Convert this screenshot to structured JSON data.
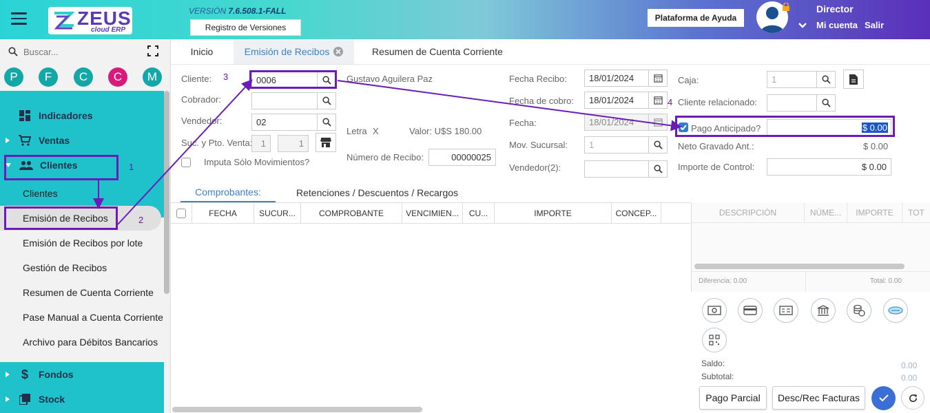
{
  "header": {
    "logo_text": "ZEUS",
    "logo_sub": "cloud ERP",
    "version_label": "VERSIÓN",
    "version_number": "7.6.508.1-FALL",
    "release_notes_button": "Registro de Versiones",
    "help_button": "Plataforma de Ayuda",
    "user_role": "Director",
    "account_link": "Mi cuenta",
    "logout_link": "Salir"
  },
  "sidebar": {
    "search_placeholder": "Buscar...",
    "favorites": [
      {
        "letter": "P",
        "color": "#14a7a7"
      },
      {
        "letter": "F",
        "color": "#14a7a7"
      },
      {
        "letter": "C",
        "color": "#14a7a7"
      },
      {
        "letter": "C",
        "color": "#d81b7a"
      },
      {
        "letter": "M",
        "color": "#14a7a7"
      }
    ],
    "sections": {
      "indicadores": "Indicadores",
      "ventas": "Ventas",
      "clientes": "Clientes",
      "fondos": "Fondos",
      "stock": "Stock"
    },
    "clientes_items": [
      "Clientes",
      "Emisión de Recibos",
      "Emisión de Recibos por lote",
      "Gestión de Recibos",
      "Resumen de Cuenta Corriente",
      "Pase Manual a Cuenta Corriente",
      "Archivo para Débitos Bancarios"
    ]
  },
  "tabs": {
    "inicio": "Inicio",
    "emision": "Emisión de Recibos",
    "resumen": "Resumen de Cuenta Corriente"
  },
  "form": {
    "cliente_label": "Cliente:",
    "cliente_value": "0006",
    "cliente_name": "Gustavo Aguilera Paz",
    "cobrador_label": "Cobrador:",
    "cobrador_value": "",
    "vendedor_label": "Vendedor:",
    "vendedor_value": "02",
    "suc_label": "Suc. y Pto. Venta:",
    "suc_value": "1",
    "pto_value": "1",
    "imputa_label": "Imputa Sólo Movimientos?",
    "letra_label": "Letra",
    "letra_value": "X",
    "valor_text": "Valor: U$S 180.00",
    "numero_label": "Número de Recibo:",
    "numero_value": "00000025",
    "fecha_recibo_label": "Fecha Recibo:",
    "fecha_recibo_value": "18/01/2024",
    "fecha_cobro_label": "Fecha de cobro:",
    "fecha_cobro_value": "18/01/2024",
    "fecha_label": "Fecha:",
    "fecha_value": "18/01/2024",
    "mov_sucursal_label": "Mov. Sucursal:",
    "mov_sucursal_value": "1",
    "vendedor2_label": "Vendedor(2):",
    "vendedor2_value": "",
    "caja_label": "Caja:",
    "caja_value": "1",
    "cliente_rel_label": "Cliente relacionado:",
    "cliente_rel_value": "",
    "pago_anticipado_label": "Pago Anticipado?",
    "pago_anticipado_value": "$ 0.00",
    "neto_label": "Neto Gravado Ant.:",
    "neto_value": "$ 0.00",
    "control_label": "Importe de Control:",
    "control_value": "$ 0.00"
  },
  "subtabs": {
    "comprobantes": "Comprobantes:",
    "retenciones": "Retenciones / Descuentos / Recargos"
  },
  "grid_columns": [
    "FECHA",
    "SUCUR...",
    "COMPROBANTE",
    "VENCIMIEN...",
    "CU...",
    "IMPORTE",
    "CONCEP..."
  ],
  "payments": {
    "columns": [
      "DESCRIPCIÓN",
      "NÚME...",
      "IMPORTE",
      "TOT"
    ],
    "diferencia": "Diferencia: 0.00",
    "total": "Total: 0.00",
    "saldo_label": "Saldo:",
    "saldo_value": "0.00",
    "subtotal_label": "Subtotal:",
    "subtotal_value": "0.00"
  },
  "buttons": {
    "pago_parcial": "Pago Parcial",
    "desc_rec": "Desc/Rec Facturas"
  },
  "annotations": {
    "a1": "1",
    "a2": "2",
    "a3": "3",
    "a4": "4"
  },
  "colors": {
    "accent": "#1fc2cb",
    "annotation": "#6a1bb8",
    "primary": "#3b6fd6"
  }
}
